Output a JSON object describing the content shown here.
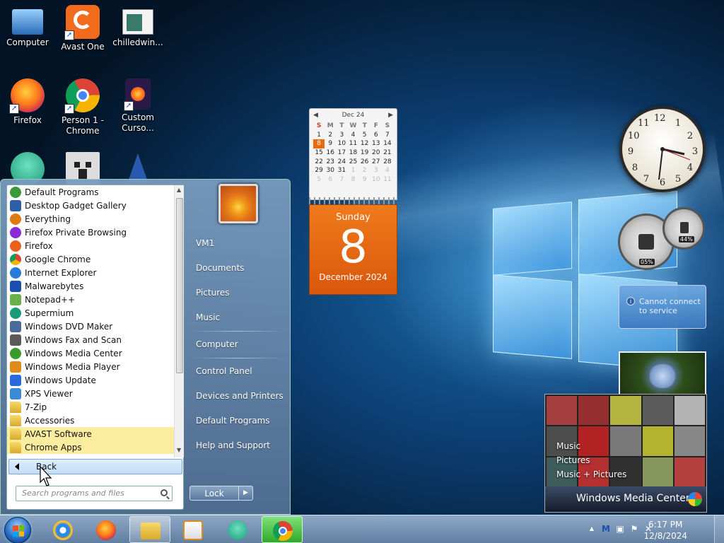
{
  "desktop": {
    "icons": [
      {
        "label": "Computer",
        "name": "computer-icon"
      },
      {
        "label": "Avast One",
        "name": "avast-one-icon"
      },
      {
        "label": "chilledwin...",
        "name": "chilledwin-icon"
      },
      {
        "label": "Firefox",
        "name": "firefox-icon"
      },
      {
        "label": "Person 1 - Chrome",
        "name": "chrome-person-icon"
      },
      {
        "label": "Custom Curso...",
        "name": "custom-cursor-icon"
      }
    ]
  },
  "calendar_gadget": {
    "month_header": "Dec 24",
    "prev_icon": "◀",
    "next_icon": "▶",
    "weekdays": [
      "S",
      "M",
      "T",
      "W",
      "T",
      "F",
      "S"
    ],
    "weeks": [
      [
        "1",
        "2",
        "3",
        "4",
        "5",
        "6",
        "7"
      ],
      [
        "8",
        "9",
        "10",
        "11",
        "12",
        "13",
        "14"
      ],
      [
        "15",
        "16",
        "17",
        "18",
        "19",
        "20",
        "21"
      ],
      [
        "22",
        "23",
        "24",
        "25",
        "26",
        "27",
        "28"
      ],
      [
        "29",
        "30",
        "31",
        "1",
        "2",
        "3",
        "4"
      ],
      [
        "5",
        "6",
        "7",
        "8",
        "9",
        "10",
        "11"
      ]
    ],
    "today_label": "8",
    "page_weekday": "Sunday",
    "page_day": "8",
    "page_month": "December 2024"
  },
  "clock_gadget": {
    "numbers": [
      "12",
      "1",
      "2",
      "3",
      "4",
      "5",
      "6",
      "7",
      "8",
      "9",
      "10",
      "11"
    ]
  },
  "meter_gadget": {
    "cpu_percent": "05%",
    "memory_percent": "44%"
  },
  "rss_gadget": {
    "message": "Cannot connect to service",
    "info_icon": "i"
  },
  "media_center_gadget": {
    "items": [
      "Music",
      "Pictures",
      "Music + Pictures"
    ],
    "brand": "Windows Media Center",
    "tile_colors": [
      "#b44",
      "#a33",
      "#cc4",
      "#666",
      "#ccc",
      "#555",
      "#c22",
      "#888",
      "#cc3",
      "#999",
      "#466",
      "#c33",
      "#333",
      "#9a6",
      "#c44"
    ]
  },
  "start_menu": {
    "programs": [
      {
        "label": "Default Programs",
        "icon": "default-programs-icon",
        "color": "#3a9a3a",
        "folder": false
      },
      {
        "label": "Desktop Gadget Gallery",
        "icon": "gadget-gallery-icon",
        "color": "#2d5fa8",
        "folder": false
      },
      {
        "label": "Everything",
        "icon": "everything-search-icon",
        "color": "#e07a10",
        "folder": false
      },
      {
        "label": "Firefox Private Browsing",
        "icon": "firefox-private-icon",
        "color": "#8a2ad8",
        "folder": false
      },
      {
        "label": "Firefox",
        "icon": "firefox-icon",
        "color": "#e8601a",
        "folder": false
      },
      {
        "label": "Google Chrome",
        "icon": "chrome-icon",
        "color": "#2fa84f",
        "folder": false
      },
      {
        "label": "Internet Explorer",
        "icon": "ie-icon",
        "color": "#2a7ad8",
        "folder": false
      },
      {
        "label": "Malwarebytes",
        "icon": "malwarebytes-icon",
        "color": "#1a4fb0",
        "folder": false
      },
      {
        "label": "Notepad++",
        "icon": "notepadpp-icon",
        "color": "#6ab04a",
        "folder": false
      },
      {
        "label": "Supermium",
        "icon": "supermium-icon",
        "color": "#1a9a7a",
        "folder": false
      },
      {
        "label": "Windows DVD Maker",
        "icon": "dvd-maker-icon",
        "color": "#4a6a9a",
        "folder": false
      },
      {
        "label": "Windows Fax and Scan",
        "icon": "fax-scan-icon",
        "color": "#5a5a5a",
        "folder": false
      },
      {
        "label": "Windows Media Center",
        "icon": "media-center-icon",
        "color": "#3a9a2a",
        "folder": false
      },
      {
        "label": "Windows Media Player",
        "icon": "media-player-icon",
        "color": "#e08a1a",
        "folder": false
      },
      {
        "label": "Windows Update",
        "icon": "windows-update-icon",
        "color": "#2a6ad8",
        "folder": false
      },
      {
        "label": "XPS Viewer",
        "icon": "xps-viewer-icon",
        "color": "#3a8ad8",
        "folder": false
      },
      {
        "label": "7-Zip",
        "icon": "folder-icon",
        "color": "#d9a92a",
        "folder": false
      },
      {
        "label": "Accessories",
        "icon": "folder-icon",
        "color": "#d9a92a",
        "folder": false
      },
      {
        "label": "AVAST Software",
        "icon": "folder-icon",
        "color": "#d9a92a",
        "folder": true
      },
      {
        "label": "Chrome Apps",
        "icon": "folder-icon",
        "color": "#d9a92a",
        "folder": true
      }
    ],
    "back_label": "Back",
    "search_placeholder": "Search programs and files",
    "right_links": [
      "VM1",
      "Documents",
      "Pictures",
      "Music",
      "Computer",
      "Control Panel",
      "Devices and Printers",
      "Default Programs",
      "Help and Support"
    ],
    "lock_label": "Lock",
    "lock_arrow": "▶"
  },
  "taskbar": {
    "buttons": [
      {
        "name": "ie-taskbar-button",
        "active": false
      },
      {
        "name": "firefox-taskbar-button",
        "active": false
      },
      {
        "name": "explorer-taskbar-button",
        "active": true
      },
      {
        "name": "media-player-taskbar-button",
        "active": false
      },
      {
        "name": "supermium-taskbar-button",
        "active": false
      },
      {
        "name": "chrome-taskbar-button",
        "active": true
      }
    ],
    "tray": {
      "expand_icon": "▲",
      "time": "6:17 PM",
      "date": "12/8/2024"
    }
  }
}
